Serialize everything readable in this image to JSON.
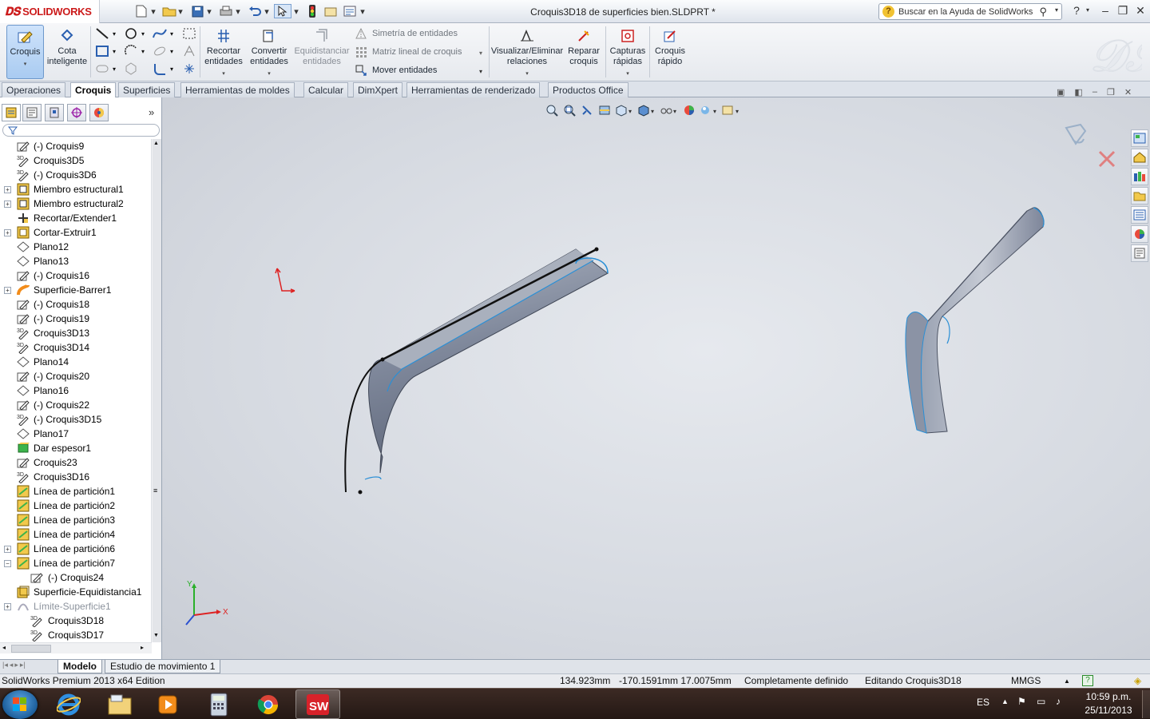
{
  "app": {
    "logo_text": "SOLIDWORKS",
    "document_title": "Croquis3D18 de superficies bien.SLDPRT *",
    "help_search_placeholder": "Buscar en la Ayuda de SolidWorks",
    "help_label": "?"
  },
  "ribbon": {
    "croquis": "Croquis",
    "cota_1": "Cota",
    "cota_2": "inteligente",
    "recortar_1": "Recortar",
    "recortar_2": "entidades",
    "convertir_1": "Convertir",
    "convertir_2": "entidades",
    "equidistanciar_1": "Equidistanciar",
    "equidistanciar_2": "entidades",
    "simetria": "Simetría de entidades",
    "matriz": "Matriz lineal de croquis",
    "mover": "Mover entidades",
    "visualizar_1": "Visualizar/Eliminar",
    "visualizar_2": "relaciones",
    "reparar_1": "Reparar",
    "reparar_2": "croquis",
    "capturas_1": "Capturas",
    "capturas_2": "rápidas",
    "croquis_rapido_1": "Croquis",
    "croquis_rapido_2": "rápido"
  },
  "command_tabs": [
    "Operaciones",
    "Croquis",
    "Superficies",
    "Herramientas de moldes",
    "Calcular",
    "DimXpert",
    "Herramientas de renderizado",
    "Productos Office"
  ],
  "tree": [
    {
      "label": "(-) Croquis9",
      "icon": "sketch-icon",
      "expand": false
    },
    {
      "label": "Croquis3D5",
      "icon": "sketch3d-icon",
      "expand": false
    },
    {
      "label": "(-) Croquis3D6",
      "icon": "sketch3d-icon",
      "expand": false
    },
    {
      "label": "Miembro estructural1",
      "icon": "structural-member-icon",
      "expand": true
    },
    {
      "label": "Miembro estructural2",
      "icon": "structural-member-icon",
      "expand": true
    },
    {
      "label": "Recortar/Extender1",
      "icon": "trim-extend-icon",
      "expand": false
    },
    {
      "label": "Cortar-Extruir1",
      "icon": "cut-extrude-icon",
      "expand": true
    },
    {
      "label": "Plano12",
      "icon": "plane-icon",
      "expand": false
    },
    {
      "label": "Plano13",
      "icon": "plane-icon",
      "expand": false
    },
    {
      "label": "(-) Croquis16",
      "icon": "sketch-icon",
      "expand": false
    },
    {
      "label": "Superficie-Barrer1",
      "icon": "surface-sweep-icon",
      "expand": true
    },
    {
      "label": "(-) Croquis18",
      "icon": "sketch-icon",
      "expand": false
    },
    {
      "label": "(-) Croquis19",
      "icon": "sketch-icon",
      "expand": false
    },
    {
      "label": "Croquis3D13",
      "icon": "sketch3d-icon",
      "expand": false
    },
    {
      "label": "Croquis3D14",
      "icon": "sketch3d-icon",
      "expand": false
    },
    {
      "label": "Plano14",
      "icon": "plane-icon",
      "expand": false
    },
    {
      "label": "(-) Croquis20",
      "icon": "sketch-icon",
      "expand": false
    },
    {
      "label": "Plano16",
      "icon": "plane-icon",
      "expand": false
    },
    {
      "label": "(-) Croquis22",
      "icon": "sketch-icon",
      "expand": false
    },
    {
      "label": "(-) Croquis3D15",
      "icon": "sketch3d-icon",
      "expand": false
    },
    {
      "label": "Plano17",
      "icon": "plane-icon",
      "expand": false
    },
    {
      "label": "Dar espesor1",
      "icon": "thicken-icon",
      "expand": false
    },
    {
      "label": "Croquis23",
      "icon": "sketch-icon",
      "expand": false
    },
    {
      "label": "Croquis3D16",
      "icon": "sketch3d-icon",
      "expand": false
    },
    {
      "label": "Línea de partición1",
      "icon": "split-line-icon",
      "expand": false
    },
    {
      "label": "Línea de partición2",
      "icon": "split-line-icon",
      "expand": false
    },
    {
      "label": "Línea de partición3",
      "icon": "split-line-icon",
      "expand": false
    },
    {
      "label": "Línea de partición4",
      "icon": "split-line-icon",
      "expand": false
    },
    {
      "label": "Línea de partición6",
      "icon": "split-line-icon",
      "expand": true
    },
    {
      "label": "Línea de partición7",
      "icon": "split-line-icon",
      "expand": true,
      "expanded": true
    },
    {
      "label": "(-) Croquis24",
      "icon": "sketch-icon",
      "expand": false,
      "child": true
    },
    {
      "label": "Superficie-Equidistancia1",
      "icon": "surface-offset-icon",
      "expand": false
    },
    {
      "label": "Límite-Superficie1",
      "icon": "boundary-surface-icon",
      "expand": true,
      "suppressed": true
    },
    {
      "label": "Croquis3D18",
      "icon": "sketch3d-icon",
      "expand": false,
      "child": true
    },
    {
      "label": "Croquis3D17",
      "icon": "sketch3d-icon",
      "expand": false,
      "child": true
    }
  ],
  "bottom_tabs": [
    "Modelo",
    "Estudio de movimiento 1"
  ],
  "status": {
    "edition": "SolidWorks Premium 2013 x64 Edition",
    "coord_x": "134.923mm",
    "coord_yz": "-170.1591mm 17.0075mm",
    "state": "Completamente definido",
    "editing": "Editando Croquis3D18",
    "units": "MMGS"
  },
  "triad": {
    "x": "X",
    "y": "Y"
  },
  "taskbar": {
    "lang": "ES",
    "time": "10:59 p.m.",
    "date": "25/11/2013"
  },
  "colors": {
    "accent": "#2d6db5",
    "edge_blue": "#2a8fd6",
    "surface": "#8f97a8"
  }
}
